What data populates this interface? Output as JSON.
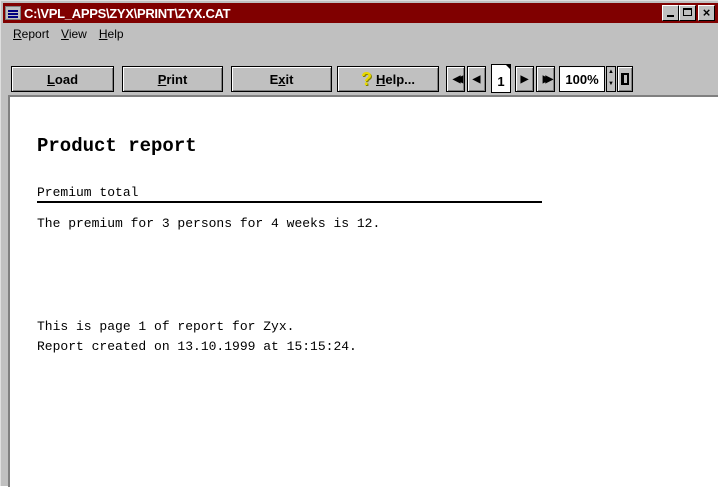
{
  "window": {
    "title": "C:\\VPL_APPS\\ZYX\\PRINT\\ZYX.CAT",
    "min": "_",
    "max": "□",
    "close": "×"
  },
  "menu": {
    "report_first": "R",
    "report_rest": "eport",
    "view_first": "V",
    "view_rest": "iew",
    "help_first": "H",
    "help_rest": "elp"
  },
  "toolbar": {
    "load_first": "L",
    "load_rest": "oad",
    "print_first": "P",
    "print_rest": "rint",
    "exit_first": "E",
    "exit_mid": "x",
    "exit_rest": "it",
    "help_first": "H",
    "help_rest": "elp...",
    "help_icon": "?",
    "first_page": "◀◀",
    "prev_page": "◀",
    "page_number": "1",
    "next_page": "▶",
    "last_page": "▶▶",
    "zoom": "100%",
    "spin_up": "▲",
    "spin_down": "▼"
  },
  "report": {
    "title": "Product report",
    "section_heading": "Premium total",
    "premium_line": "The premium for 3 persons for 4 weeks is 12.",
    "page_line": "This is page 1 of report for Zyx.",
    "created_line": "Report created on 13.10.1999 at 15:15:24."
  },
  "colors": {
    "titlebar": "#800000",
    "chrome": "#c0c0c0",
    "help_icon": "#e8d800"
  }
}
